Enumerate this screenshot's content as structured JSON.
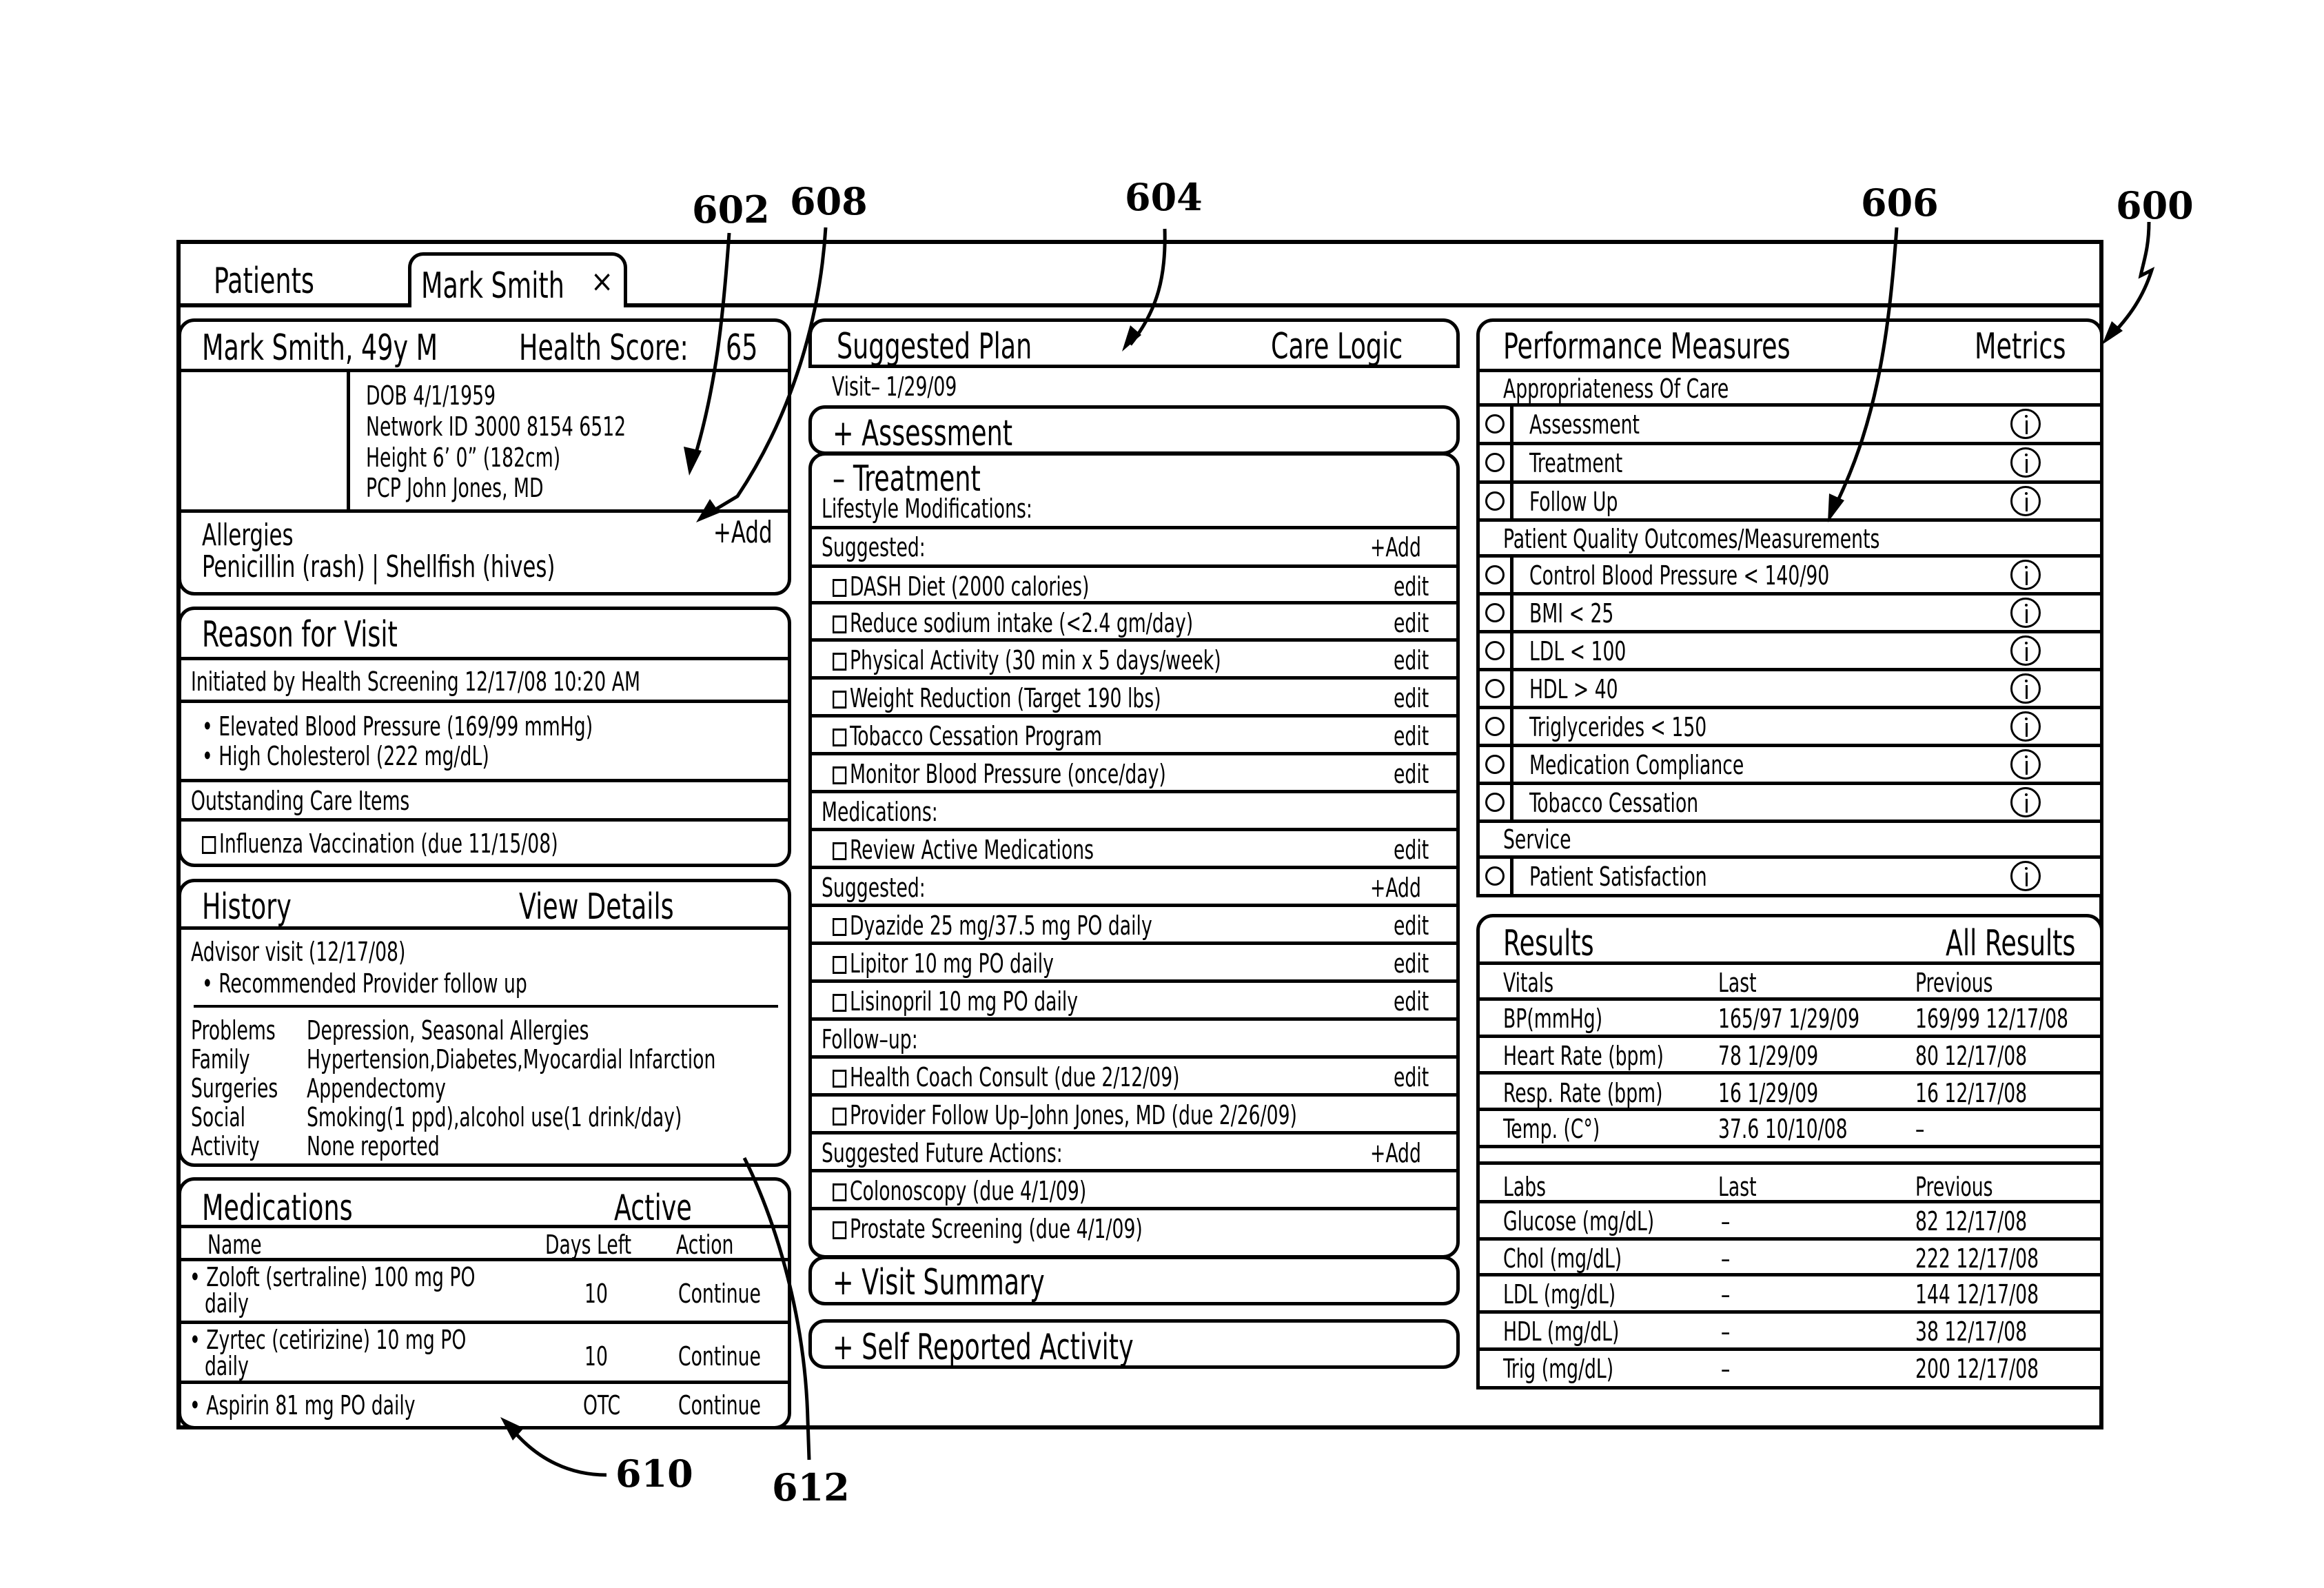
{
  "figure_refs": {
    "r600": "600",
    "r602": "602",
    "r604": "604",
    "r606": "606",
    "r608": "608",
    "r610": "610",
    "r612": "612"
  },
  "tabs": {
    "patients": "Patients",
    "active_tab": "Mark Smith",
    "close_glyph": "×"
  },
  "patient": {
    "name_age_sex": "Mark Smith, 49y M",
    "health_score_label": "Health Score:",
    "health_score": "65",
    "details": [
      "DOB 4/1/1959",
      "Network ID 3000 8154 6512",
      "Height 6’ 0” (182cm)",
      "PCP John Jones, MD"
    ],
    "allergies_label": "Allergies",
    "allergies_add": "+Add",
    "allergies": "Penicillin (rash) | Shellfish (hives)"
  },
  "reason_for_visit": {
    "title": "Reason for Visit",
    "initiated": "Initiated by Health Screening 12/17/08 10:20 AM",
    "bullets": [
      "Elevated Blood Pressure (169/99 mmHg)",
      "High Cholesterol (222 mg/dL)"
    ],
    "outstanding_label": "Outstanding Care Items",
    "outstanding_items": [
      "Influenza Vaccination (due 11/15/08)"
    ]
  },
  "history": {
    "title": "History",
    "view_details": "View Details",
    "advisor_visit": "Advisor visit (12/17/08)",
    "advisor_bullet": "Recommended Provider follow up",
    "rows": [
      {
        "label": "Problems",
        "value": "Depression, Seasonal Allergies"
      },
      {
        "label": "Family",
        "value": "Hypertension,Diabetes,Myocardial Infarction"
      },
      {
        "label": "Surgeries",
        "value": "Appendectomy"
      },
      {
        "label": "Social",
        "value": "Smoking(1 ppd),alcohol use(1 drink/day)"
      },
      {
        "label": "Activity",
        "value": "None reported"
      }
    ]
  },
  "medications": {
    "title": "Medications",
    "filter": "Active",
    "columns": [
      "Name",
      "Days Left",
      "Action"
    ],
    "rows": [
      {
        "name_l1": "Zoloft (sertraline) 100 mg PO",
        "name_l2": "daily",
        "days": "10",
        "action": "Continue"
      },
      {
        "name_l1": "Zyrtec (cetirizine) 10 mg PO",
        "name_l2": "daily",
        "days": "10",
        "action": "Continue"
      },
      {
        "name_l1": "Aspirin 81 mg PO daily",
        "name_l2": "",
        "days": "OTC",
        "action": "Continue"
      }
    ]
  },
  "plan": {
    "title": "Suggested Plan",
    "care_logic": "Care Logic",
    "visit": "Visit– 1/29/09",
    "assessment": "+ Assessment",
    "treatment": "– Treatment",
    "lifestyle_label": "Lifestyle Modifications:",
    "suggested_label": "Suggested:",
    "add": "+Add",
    "edit": "edit",
    "lifestyle_items": [
      "DASH Diet (2000 calories)",
      "Reduce sodium intake (<2.4 gm/day)",
      "Physical Activity (30 min x 5 days/week)",
      "Weight Reduction (Target 190 lbs)",
      "Tobacco Cessation Program",
      "Monitor Blood Pressure (once/day)"
    ],
    "medications_label": "Medications:",
    "medication_review": "Review Active Medications",
    "suggested_meds": [
      "Dyazide 25 mg/37.5 mg PO daily",
      "Lipitor 10 mg PO daily",
      "Lisinopril 10 mg PO daily"
    ],
    "followup_label": "Follow–up:",
    "followups": [
      "Health Coach Consult (due 2/12/09)",
      "Provider Follow Up–John Jones, MD (due 2/26/09)"
    ],
    "future_label": "Suggested Future Actions:",
    "future_items": [
      "Colonoscopy (due 4/1/09)",
      "Prostate Screening (due 4/1/09)"
    ],
    "visit_summary": "+ Visit Summary",
    "self_reported": "+ Self Reported Activity"
  },
  "performance": {
    "title": "Performance Measures",
    "metrics": "Metrics",
    "groups": [
      {
        "label": "Appropriateness Of Care",
        "items": [
          "Assessment",
          "Treatment",
          "Follow Up"
        ]
      },
      {
        "label": "Patient Quality Outcomes/Measurements",
        "items": [
          "Control Blood Pressure < 140/90",
          "BMI < 25",
          "LDL < 100",
          "HDL > 40",
          "Triglycerides < 150",
          "Medication Compliance",
          "Tobacco Cessation"
        ]
      },
      {
        "label": "Service",
        "items": [
          "Patient Satisfaction"
        ]
      }
    ]
  },
  "results": {
    "title": "Results",
    "all_results": "All Results",
    "vitals_header": [
      "Vitals",
      "Last",
      "Previous"
    ],
    "vitals": [
      [
        "BP(mmHg)",
        "165/97 1/29/09",
        "169/99 12/17/08"
      ],
      [
        "Heart Rate (bpm)",
        "78 1/29/09",
        "80 12/17/08"
      ],
      [
        "Resp. Rate (bpm)",
        "16 1/29/09",
        "16 12/17/08"
      ],
      [
        "Temp. (C°)",
        "37.6 10/10/08",
        "–"
      ]
    ],
    "labs_header": [
      "Labs",
      "Last",
      "Previous"
    ],
    "labs": [
      [
        "Glucose (mg/dL)",
        "–",
        "82 12/17/08"
      ],
      [
        "Chol (mg/dL)",
        "–",
        "222 12/17/08"
      ],
      [
        "LDL (mg/dL)",
        "–",
        "144 12/17/08"
      ],
      [
        "HDL (mg/dL)",
        "–",
        "38 12/17/08"
      ],
      [
        "Trig (mg/dL)",
        "–",
        "200 12/17/08"
      ]
    ]
  }
}
